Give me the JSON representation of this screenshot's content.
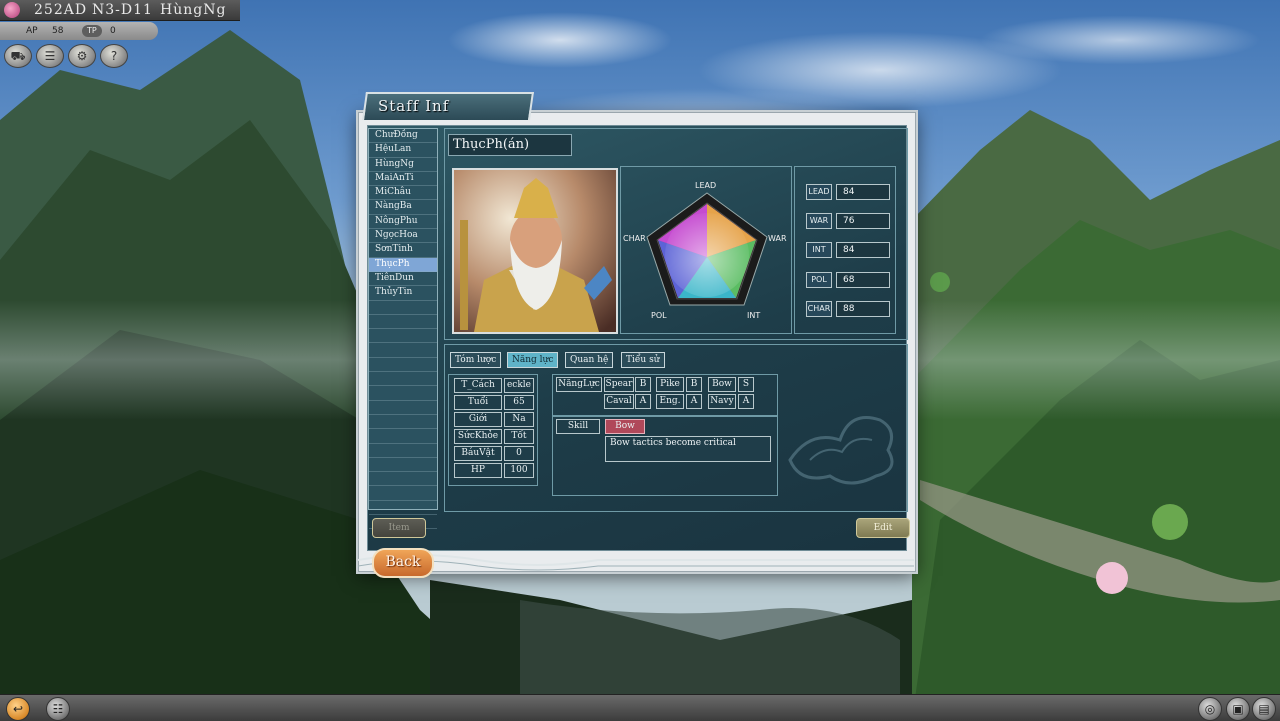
{
  "hud": {
    "date": "252AD",
    "town": "N3-D11",
    "ruler": "HùngNg",
    "ap_label": "AP",
    "ap_value": "58",
    "tp_label": "TP",
    "tp_value": "0",
    "buttons": [
      "cart-icon",
      "list-icon",
      "gear-icon",
      "help-icon"
    ]
  },
  "dialog": {
    "title": "Staff Inf",
    "staff_list": [
      "ChưĐồng",
      "HệuLan",
      "HùngNg",
      "MaiAnTi",
      "MiChâu",
      "NàngBa",
      "NôngPhu",
      "NgọcHoa",
      "SơnTinh",
      "ThụcPh",
      "TiênDun",
      "ThủyTin"
    ],
    "selected_index": 9,
    "officer_name": "ThụcPh(án)",
    "radar": {
      "labels": [
        "LEAD",
        "WAR",
        "INT",
        "POL",
        "CHAR"
      ]
    },
    "stats": [
      {
        "key": "LEAD",
        "value": "84"
      },
      {
        "key": "WAR",
        "value": "76"
      },
      {
        "key": "INT",
        "value": "84"
      },
      {
        "key": "POL",
        "value": "68"
      },
      {
        "key": "CHAR",
        "value": "88"
      }
    ],
    "tabs": [
      "Tóm lược",
      "Năng lực",
      "Quan hệ",
      "Tiểu sử"
    ],
    "active_tab": 1,
    "info": [
      {
        "key": "T_Cách",
        "value": "eckle"
      },
      {
        "key": "Tuổi",
        "value": "65"
      },
      {
        "key": "Giới",
        "value": "Na"
      },
      {
        "key": "SứcKhỏe",
        "value": "Tốt"
      },
      {
        "key": "BáuVật",
        "value": "0"
      },
      {
        "key": "HP",
        "value": "100"
      }
    ],
    "ability_label": "NăngLực",
    "abilities": [
      {
        "name": "Spear",
        "rank": "B"
      },
      {
        "name": "Pike",
        "rank": "B"
      },
      {
        "name": "Bow",
        "rank": "S"
      },
      {
        "name": "Caval",
        "rank": "A"
      },
      {
        "name": "Eng.",
        "rank": "A"
      },
      {
        "name": "Navy",
        "rank": "A"
      }
    ],
    "skill_label": "Skill",
    "skill_name": "Bow",
    "skill_desc": "Bow tactics become critical",
    "item_button": "Item",
    "edit_button": "Edit",
    "back_button": "Back"
  },
  "colors": {
    "panel": "#1e3d49",
    "accent_tab": "#5fb3c8",
    "selected_row": "#7fa6d6",
    "skill_badge": "#b0485a",
    "back_button": "#e08a40"
  }
}
